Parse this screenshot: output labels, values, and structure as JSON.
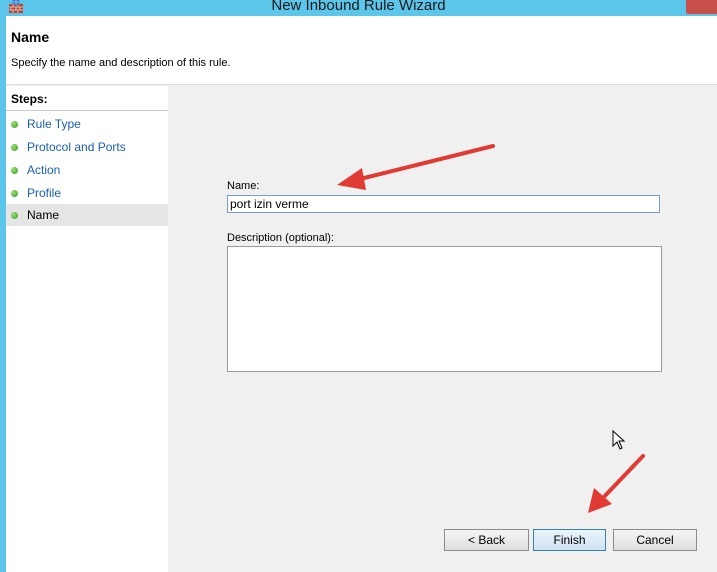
{
  "window": {
    "title": "New Inbound Rule Wizard",
    "app_icon": "firewall-rule-icon",
    "close_icon": "close-icon"
  },
  "header": {
    "title": "Name",
    "subtitle": "Specify the name and description of this rule."
  },
  "steps": {
    "heading": "Steps:",
    "items": [
      {
        "label": "Rule Type",
        "current": false
      },
      {
        "label": "Protocol and Ports",
        "current": false
      },
      {
        "label": "Action",
        "current": false
      },
      {
        "label": "Profile",
        "current": false
      },
      {
        "label": "Name",
        "current": true
      }
    ]
  },
  "form": {
    "name_label": "Name:",
    "name_value": "port izin verme",
    "description_label": "Description (optional):",
    "description_value": ""
  },
  "buttons": {
    "back": "< Back",
    "finish": "Finish",
    "cancel": "Cancel"
  },
  "colors": {
    "title_bar": "#5cc6ea",
    "step_link": "#1a5fb4",
    "annotation_arrow": "#e03a33"
  }
}
